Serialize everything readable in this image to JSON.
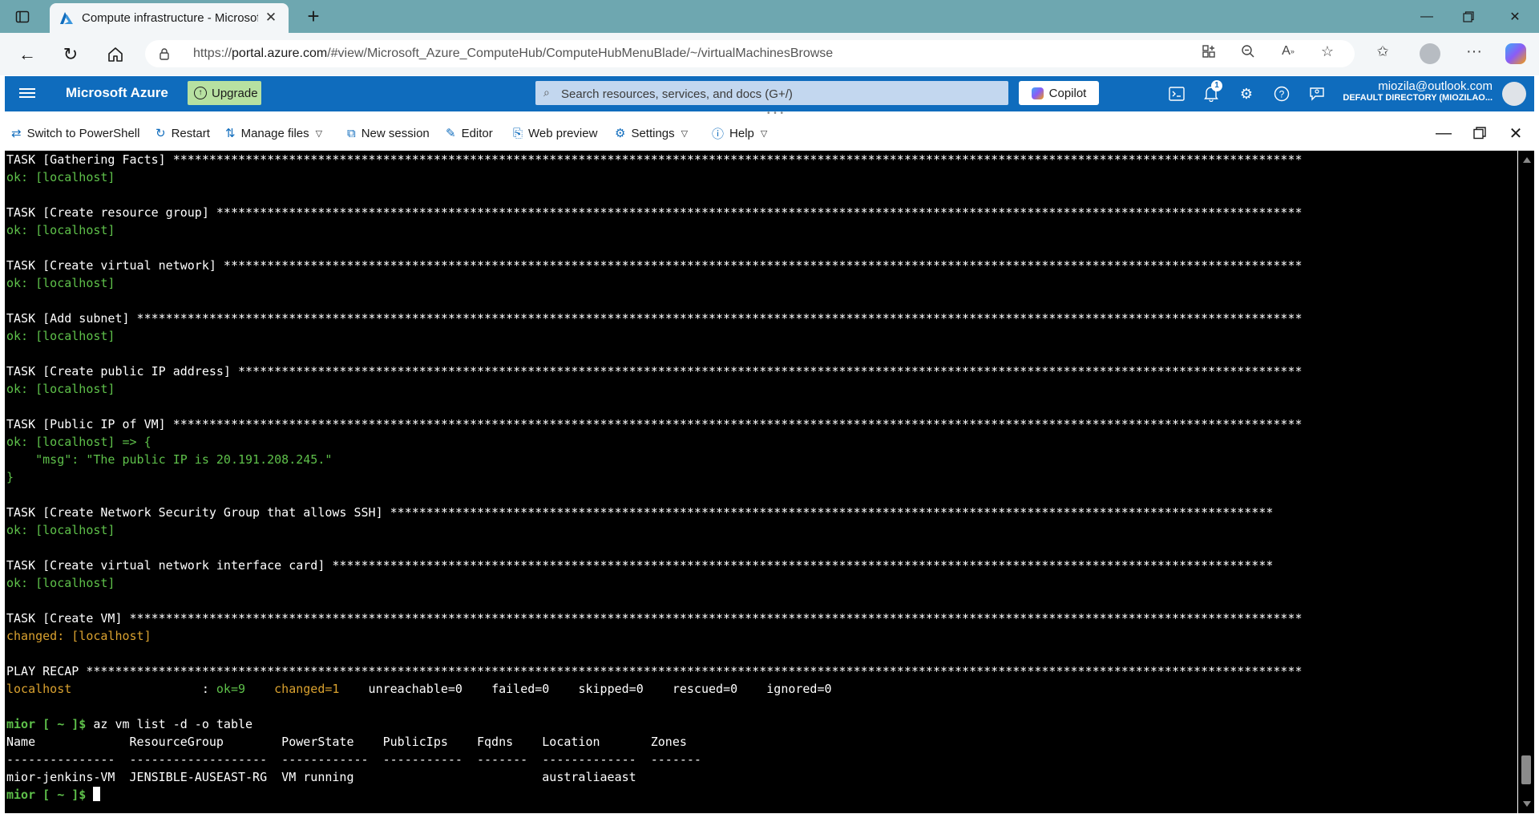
{
  "browser": {
    "tab_title": "Compute infrastructure - Microsoft Azure",
    "url_prefix": "https://",
    "url_host": "portal.azure.com",
    "url_path": "/#view/Microsoft_Azure_ComputeHub/ComputeHubMenuBlade/~/virtualMachinesBrowse"
  },
  "azure_header": {
    "brand": "Microsoft Azure",
    "upgrade_label": "Upgrade",
    "search_placeholder": "Search resources, services, and docs (G+/)",
    "copilot_label": "Copilot",
    "notifications_count": "1",
    "account_email": "miozila@outlook.com",
    "account_directory": "DEFAULT DIRECTORY (MIOZILAO..."
  },
  "shell_toolbar": {
    "switch_label": "Switch to PowerShell",
    "restart_label": "Restart",
    "manage_files_label": "Manage files",
    "new_session_label": "New session",
    "editor_label": "Editor",
    "web_preview_label": "Web preview",
    "settings_label": "Settings",
    "help_label": "Help"
  },
  "terminal": {
    "lines": [
      [
        {
          "t": "TASK [Gathering Facts] ************************************************************************************************************************************************************",
          "c": ""
        }
      ],
      [
        {
          "t": "ok: [localhost]",
          "c": "g"
        }
      ],
      [],
      [
        {
          "t": "TASK [Create resource group] ******************************************************************************************************************************************************",
          "c": ""
        }
      ],
      [
        {
          "t": "ok: [localhost]",
          "c": "g"
        }
      ],
      [],
      [
        {
          "t": "TASK [Create virtual network] *****************************************************************************************************************************************************",
          "c": ""
        }
      ],
      [
        {
          "t": "ok: [localhost]",
          "c": "g"
        }
      ],
      [],
      [
        {
          "t": "TASK [Add subnet] *****************************************************************************************************************************************************************",
          "c": ""
        }
      ],
      [
        {
          "t": "ok: [localhost]",
          "c": "g"
        }
      ],
      [],
      [
        {
          "t": "TASK [Create public IP address] ***************************************************************************************************************************************************",
          "c": ""
        }
      ],
      [
        {
          "t": "ok: [localhost]",
          "c": "g"
        }
      ],
      [],
      [
        {
          "t": "TASK [Public IP of VM] ************************************************************************************************************************************************************",
          "c": ""
        }
      ],
      [
        {
          "t": "ok: [localhost] => {",
          "c": "g"
        }
      ],
      [
        {
          "t": "    \"msg\": \"The public IP is 20.191.208.245.\"",
          "c": "g"
        }
      ],
      [
        {
          "t": "}",
          "c": "g"
        }
      ],
      [],
      [
        {
          "t": "TASK [Create Network Security Group that allows SSH] **************************************************************************************************************************",
          "c": ""
        }
      ],
      [
        {
          "t": "ok: [localhost]",
          "c": "g"
        }
      ],
      [],
      [
        {
          "t": "TASK [Create virtual network interface card] **********************************************************************************************************************************",
          "c": ""
        }
      ],
      [
        {
          "t": "ok: [localhost]",
          "c": "g"
        }
      ],
      [],
      [
        {
          "t": "TASK [Create VM] ******************************************************************************************************************************************************************",
          "c": ""
        }
      ],
      [
        {
          "t": "changed: [localhost]",
          "c": "y"
        }
      ],
      [],
      [
        {
          "t": "PLAY RECAP ************************************************************************************************************************************************************************",
          "c": ""
        }
      ],
      [
        {
          "t": "localhost",
          "c": "y"
        },
        {
          "t": "                  : ",
          "c": ""
        },
        {
          "t": "ok=9",
          "c": "g"
        },
        {
          "t": "    ",
          "c": ""
        },
        {
          "t": "changed=1",
          "c": "y"
        },
        {
          "t": "    unreachable=0    failed=0    skipped=0    rescued=0    ignored=0",
          "c": ""
        }
      ],
      [],
      [
        {
          "t": "mior [ ~ ]$",
          "c": "g bold"
        },
        {
          "t": " az vm list -d -o table",
          "c": ""
        }
      ],
      [
        {
          "t": "Name             ResourceGroup        PowerState    PublicIps    Fqdns    Location       Zones",
          "c": ""
        }
      ],
      [
        {
          "t": "---------------  -------------------  ------------  -----------  -------  -------------  -------",
          "c": ""
        }
      ],
      [
        {
          "t": "mior-jenkins-VM  JENSIBLE-AUSEAST-RG  VM running                          australiaeast",
          "c": ""
        }
      ],
      [
        {
          "t": "mior [ ~ ]$",
          "c": "g bold"
        },
        {
          "t": " ",
          "c": ""
        },
        {
          "t": "",
          "c": "cursor"
        }
      ]
    ]
  },
  "colors": {
    "tab_strip": "#6ea7b0",
    "azure_blue": "#0f6cbd",
    "terminal_bg": "#000000",
    "ok_green": "#5ec04a",
    "changed_yellow": "#d9a12f"
  }
}
